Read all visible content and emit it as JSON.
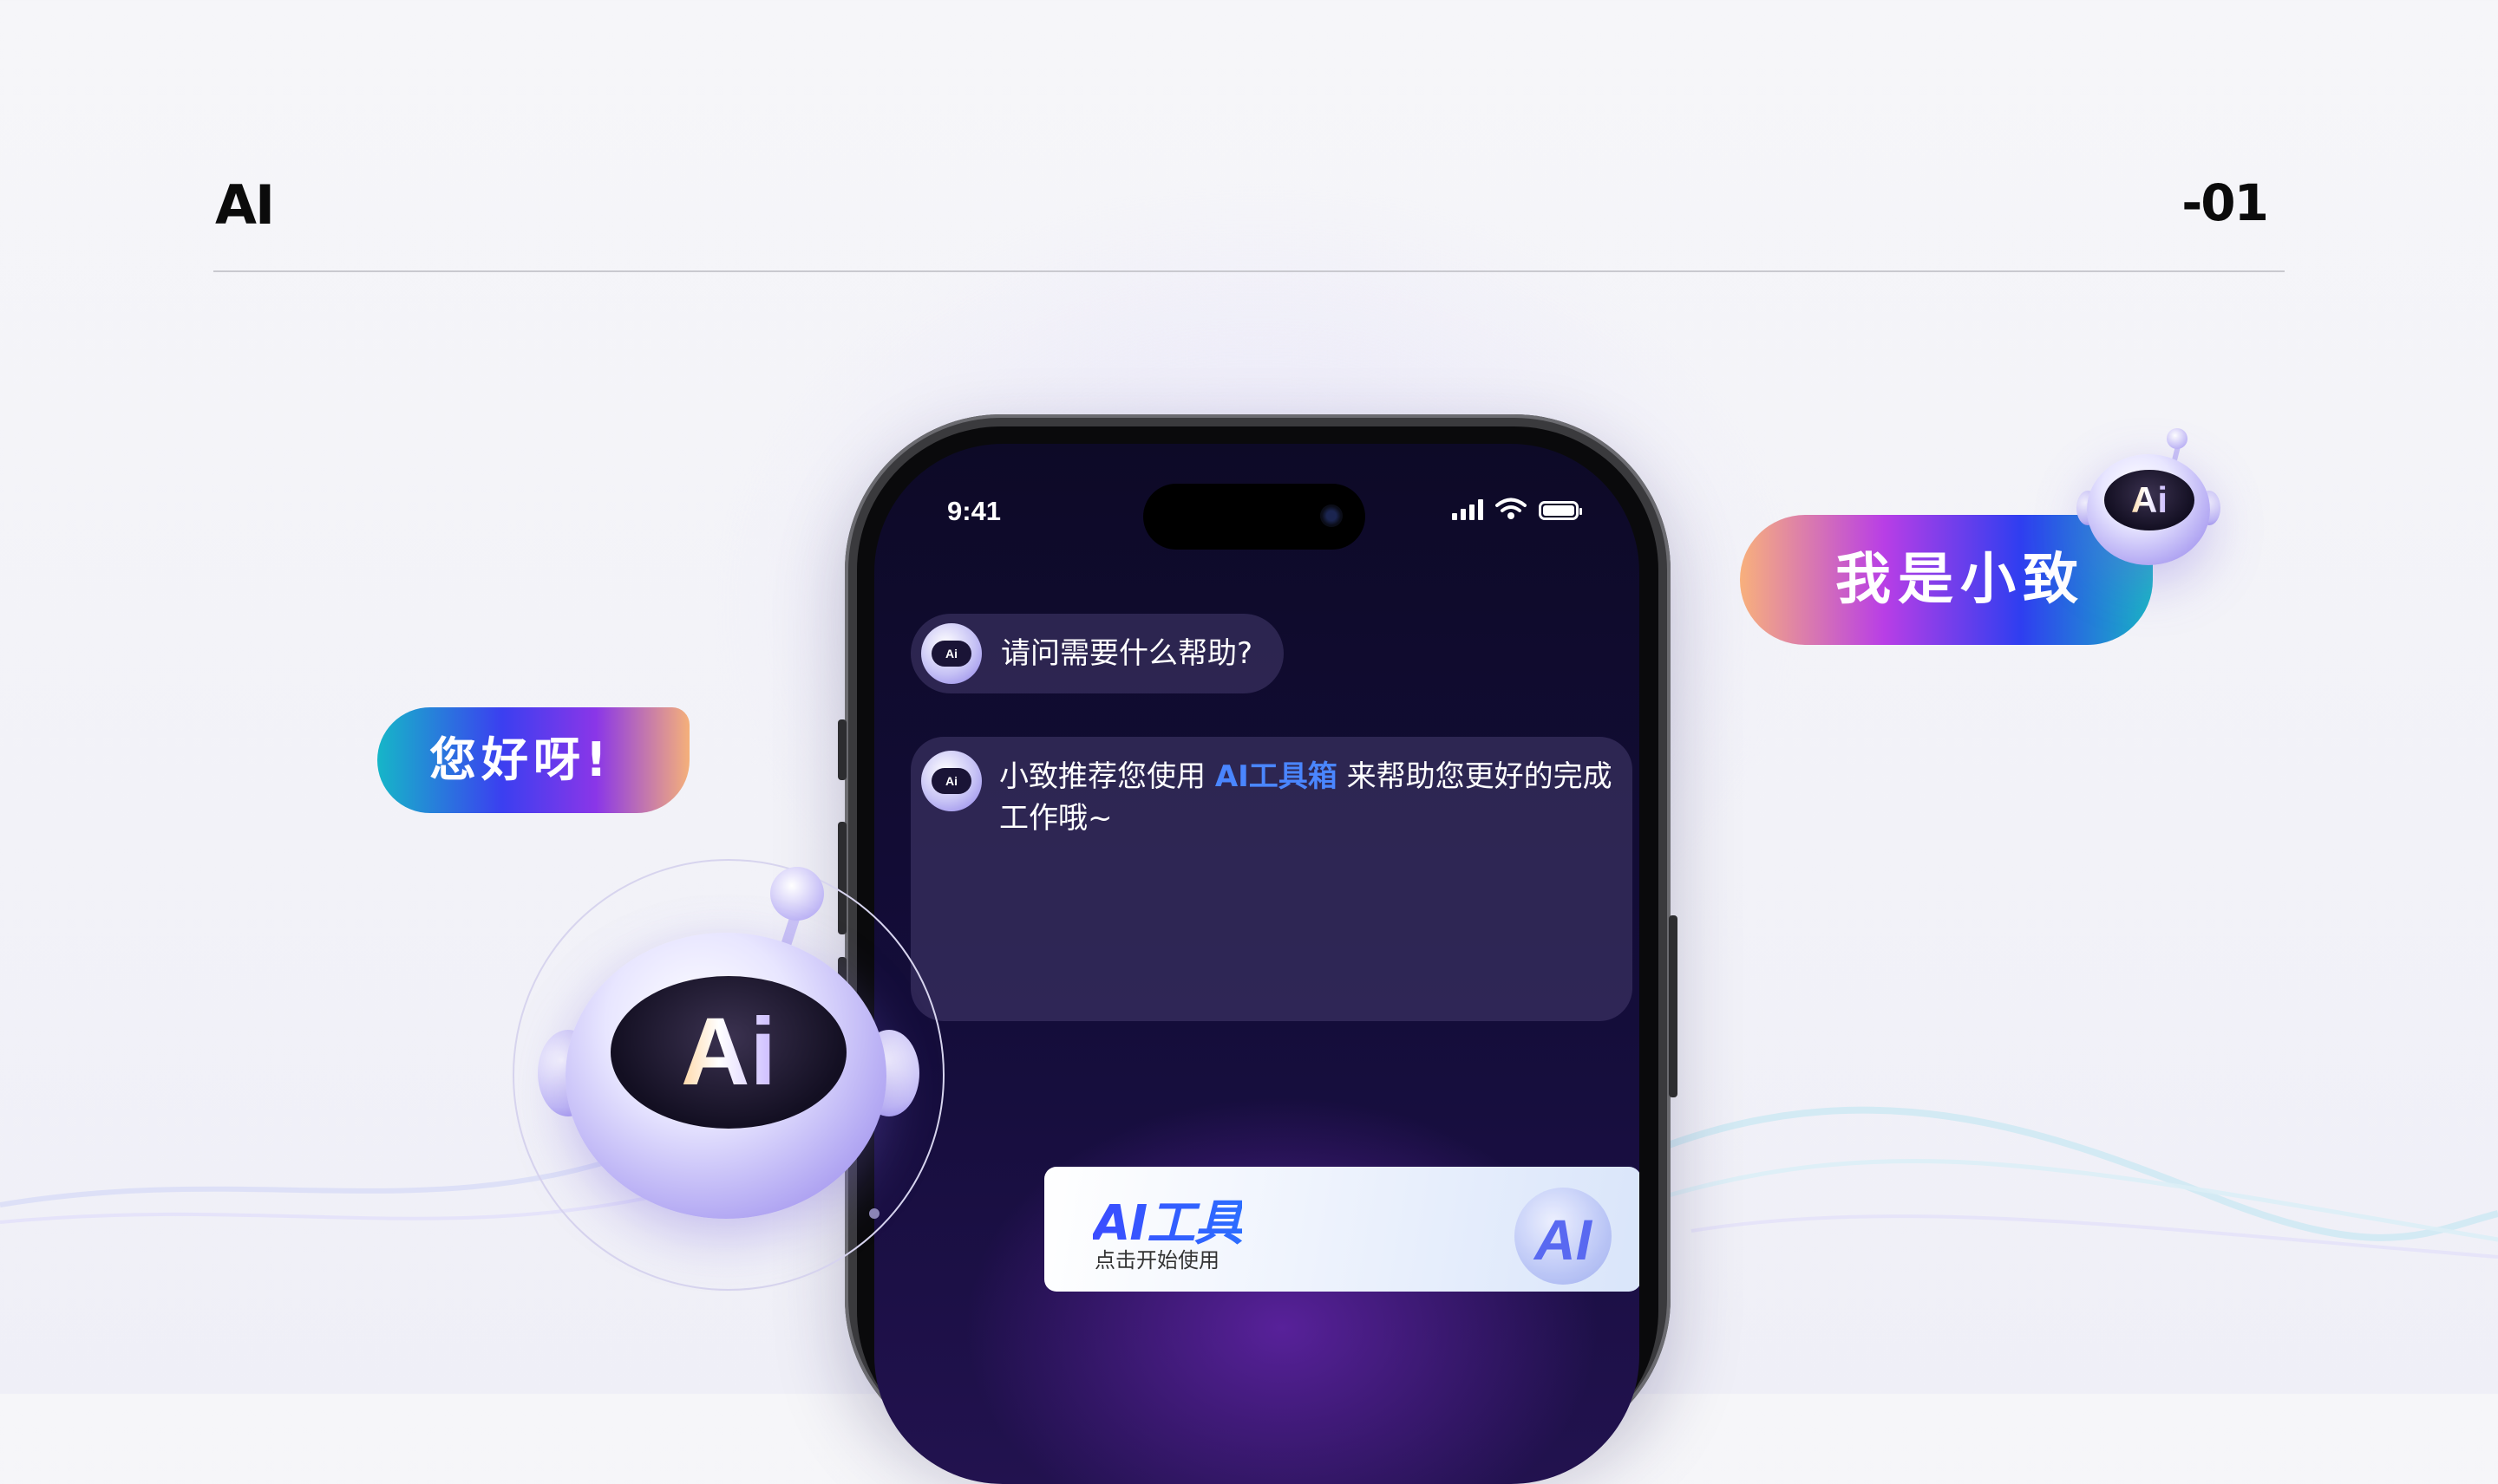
{
  "header": {
    "title": "AI",
    "number": "-01"
  },
  "phone": {
    "status_time": "9:41",
    "chat": {
      "message1": "请问需要什么帮助?",
      "message2_prefix": "小致推荐您使用 ",
      "message2_highlight": "AI工具箱",
      "message2_suffix": " 来帮助您更好的完成工作哦~",
      "avatar_label": "Ai"
    },
    "tool_card": {
      "title": "AI工具",
      "subtitle": "点击开始使用",
      "badge": "AI"
    }
  },
  "bubbles": {
    "left": "您好呀!",
    "right": "我是小致"
  },
  "robots": {
    "large_label": "Ai",
    "small_label": "Ai"
  },
  "colors": {
    "accent_blue": "#4a86ff",
    "screen_dark": "#0d0a27",
    "gradient_teal": "#16b6c8",
    "gradient_purple": "#8a36e8",
    "gradient_peach": "#f5b07a"
  }
}
